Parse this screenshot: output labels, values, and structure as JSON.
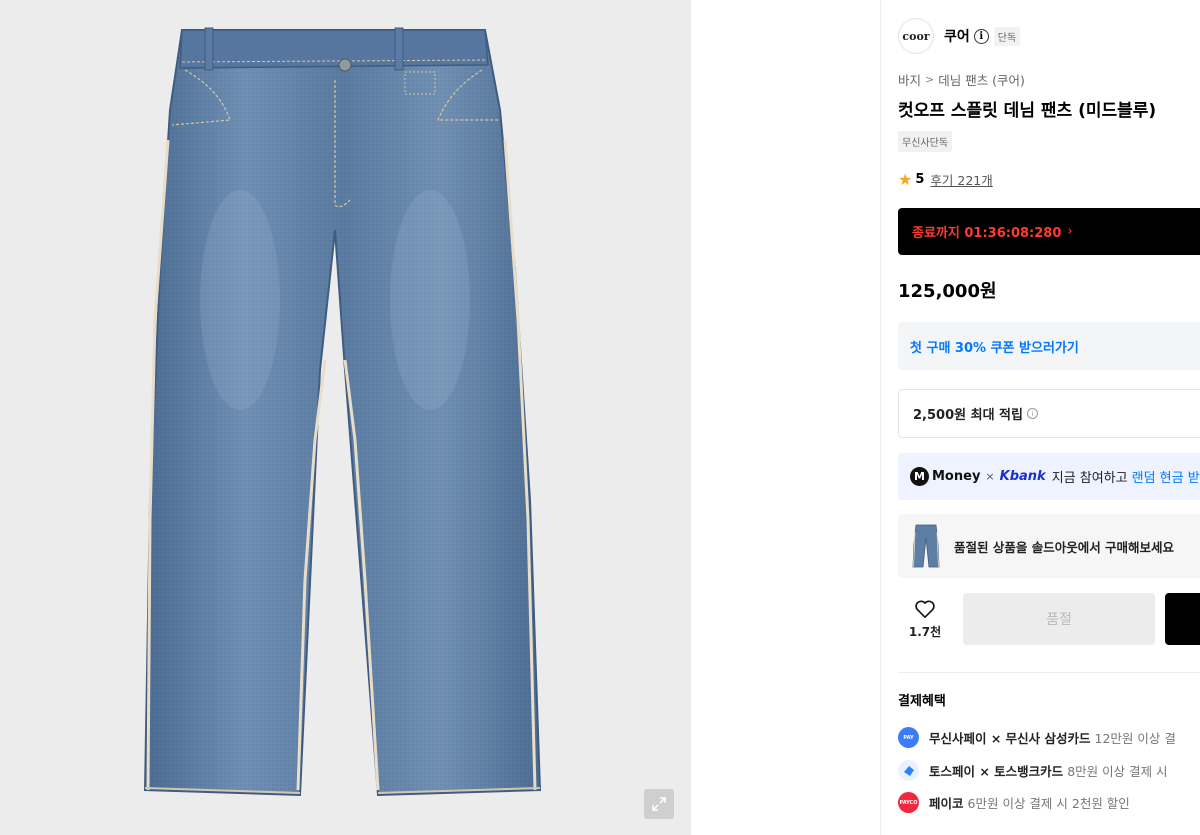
{
  "brand": {
    "logo_text": "coor",
    "name": "쿠어",
    "info_icon": "info-icon",
    "exclusive_badge": "단독"
  },
  "breadcrumb": {
    "category": "바지",
    "separator": ">",
    "subcategory": "데님 팬츠 (쿠어)"
  },
  "product": {
    "title": "컷오프 스플릿 데님 팬츠 (미드블루)",
    "tag": "무신사단독",
    "rating_score": "5",
    "reviews_label": "후기 221개",
    "price": "125,000원"
  },
  "timer": {
    "label": "종료까지 01:36:08:280",
    "chevron": "›"
  },
  "coupon": {
    "label": "첫 구매 30% 쿠폰 받으러가기"
  },
  "points": {
    "label": "2,500원 최대 적립",
    "info_glyph": "i"
  },
  "promo": {
    "m_logo": "M",
    "money": "Money",
    "times": "×",
    "kbank": "Kbank",
    "text": "지금 참여하고",
    "highlight": "랜덤 현금 받"
  },
  "soldout": {
    "label": "품절된 상품을 솔드아웃에서 구매해보세요"
  },
  "actions": {
    "like_count": "1.7천",
    "soldout_button": "품절"
  },
  "benefits": {
    "title": "결제혜택",
    "items": [
      {
        "logo_text": "musinsa pay",
        "color": "#3b7cff",
        "bold": "무신사페이 × 무신사 삼성카드",
        "rest": "12만원 이상 결"
      },
      {
        "logo_text": "toss",
        "color": "#2f80ff",
        "bold": "토스페이 × 토스뱅크카드",
        "rest": "8만원 이상 결제 시"
      },
      {
        "logo_text": "payco",
        "color": "#f2263d",
        "bold": "페이코",
        "rest": "6만원 이상 결제 시 2천원 할인"
      }
    ]
  },
  "colors": {
    "timer_text": "#ff3b30",
    "coupon_text": "#0078ff",
    "kbank": "#1a2fd0",
    "star": "#f5a623",
    "denim_main": "#5f7ea3"
  }
}
